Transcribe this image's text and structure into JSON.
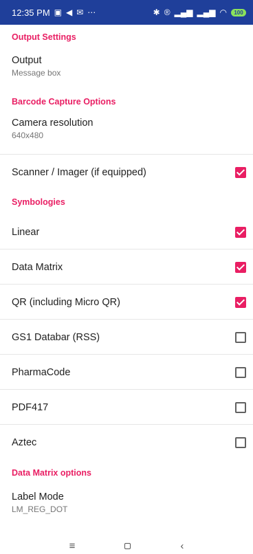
{
  "status_bar": {
    "time": "12:35 PM",
    "left_icons": [
      "message-icon",
      "send-icon",
      "mail-icon",
      "more-icon"
    ],
    "right_icons": [
      "bluetooth-icon",
      "registered-icon",
      "signal-icon",
      "signal-icon",
      "wifi-icon",
      "battery-icon"
    ],
    "battery_level": "100"
  },
  "sections": {
    "output_settings": "Output Settings",
    "barcode_capture_options": "Barcode Capture Options",
    "symbologies": "Symbologies",
    "data_matrix_options": "Data Matrix options"
  },
  "prefs": {
    "output": {
      "title": "Output",
      "summary": "Message box"
    },
    "camera_resolution": {
      "title": "Camera resolution",
      "summary": "640x480"
    },
    "scanner_imager": {
      "title": "Scanner / Imager (if equipped)",
      "checked": true
    },
    "linear": {
      "title": "Linear",
      "checked": true
    },
    "data_matrix": {
      "title": "Data Matrix",
      "checked": true
    },
    "qr": {
      "title": "QR (including Micro QR)",
      "checked": true
    },
    "gs1_databar": {
      "title": "GS1 Databar (RSS)",
      "checked": false
    },
    "pharmacode": {
      "title": "PharmaCode",
      "checked": false
    },
    "pdf417": {
      "title": "PDF417",
      "checked": false
    },
    "aztec": {
      "title": "Aztec",
      "checked": false
    },
    "label_mode": {
      "title": "Label Mode",
      "summary": "LM_REG_DOT"
    }
  },
  "nav_bar": {
    "menu_glyph": "≡",
    "back_glyph": "‹"
  },
  "colors": {
    "accent": "#e91e63",
    "status_bar": "#1f3f9a"
  }
}
